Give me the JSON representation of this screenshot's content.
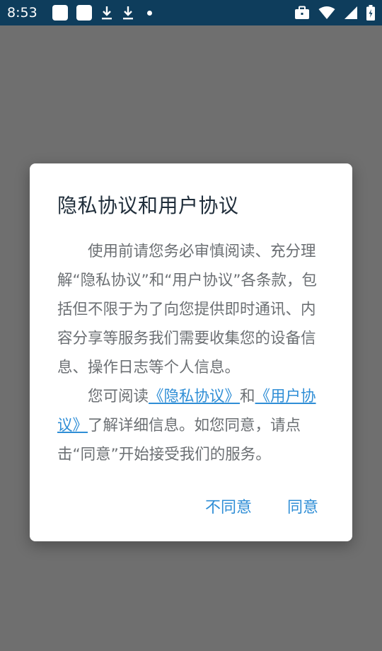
{
  "status_bar": {
    "time": "8:53",
    "left_icons": [
      "app-icon",
      "app-icon",
      "download-icon",
      "download-icon",
      "notification-dot-icon"
    ],
    "right_icons": [
      "briefcase-icon",
      "wifi-icon",
      "signal-icon",
      "battery-charging-icon"
    ]
  },
  "dialog": {
    "title": "隐私协议和用户协议",
    "para1": "使用前请您务必审慎阅读、充分理解“隐私协议”和“用户协议”各条款，包括但不限于为了向您提供即时通讯、内容分享等服务我们需要收集您的设备信息、操作日志等个人信息。",
    "para2_prefix": "您可阅读",
    "privacy_link": "《隐私协议》",
    "and": "和",
    "user_link": "《用户协议》",
    "para2_suffix": "了解详细信息。如您同意，请点击“同意”开始接受我们的服务。",
    "disagree_label": "不同意",
    "agree_label": "同意"
  },
  "colors": {
    "status_bar": "#0e3d5c",
    "scrim": "#6f6f6f",
    "accent": "#2f8ed6",
    "body_text": "#6b6f73"
  }
}
